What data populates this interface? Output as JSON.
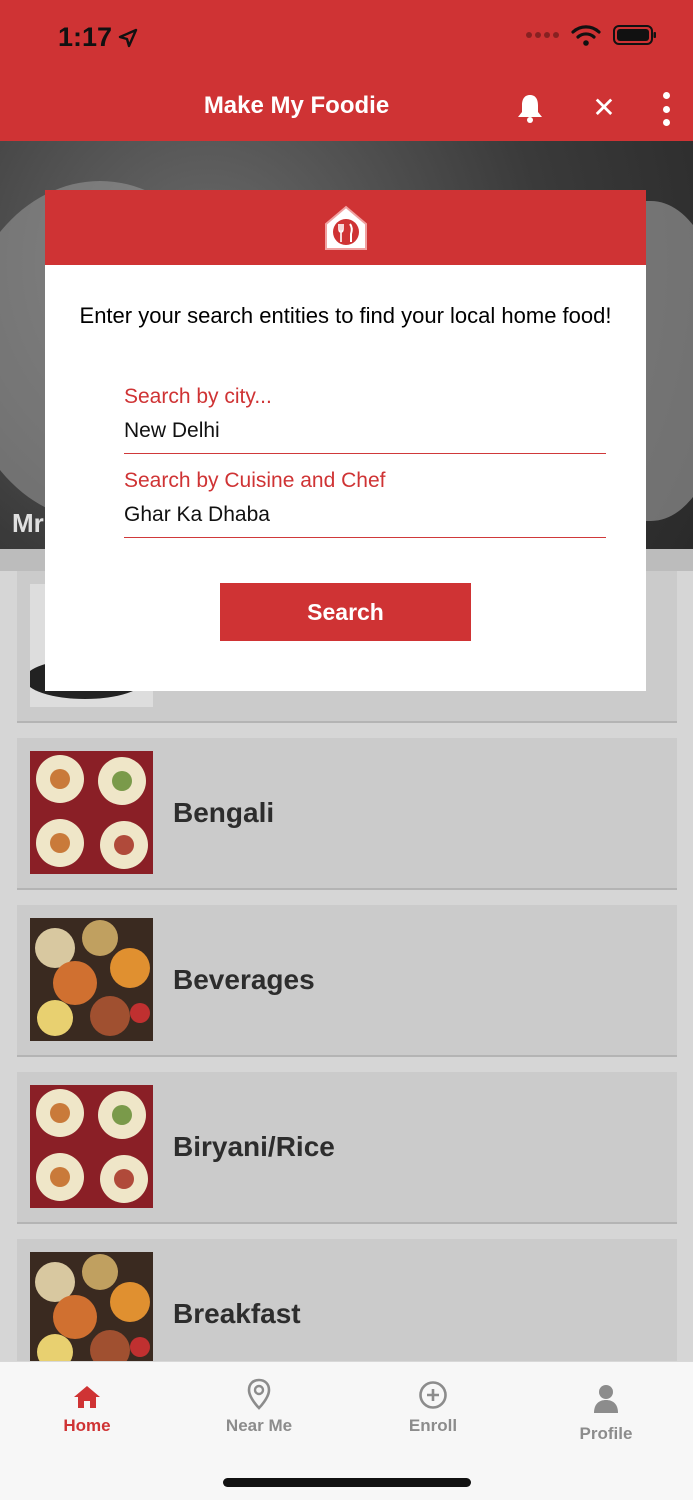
{
  "status_bar": {
    "time": "1:17"
  },
  "header": {
    "title": "Make My Foodie"
  },
  "banner": {
    "text": "Mr"
  },
  "modal": {
    "message": "Enter your search entities to find your local home food!",
    "city_field": {
      "label": "Search by city...",
      "value": "New Delhi"
    },
    "cuisine_field": {
      "label": "Search by Cuisine and Chef",
      "value": "Ghar Ka Dhaba"
    },
    "search_label": "Search"
  },
  "categories": [
    {
      "label": ""
    },
    {
      "label": "Bengali"
    },
    {
      "label": "Beverages"
    },
    {
      "label": "Biryani/Rice"
    },
    {
      "label": "Breakfast"
    }
  ],
  "tabbar": {
    "items": [
      {
        "label": "Home",
        "icon": "home-icon",
        "active": true
      },
      {
        "label": "Near Me",
        "icon": "location-pin-icon"
      },
      {
        "label": "Enroll",
        "icon": "plus-circle-icon"
      },
      {
        "label": "Profile",
        "icon": "person-icon"
      }
    ]
  },
  "colors": {
    "brand_red": "#cf3334",
    "card_gray": "#cbcbcb"
  }
}
